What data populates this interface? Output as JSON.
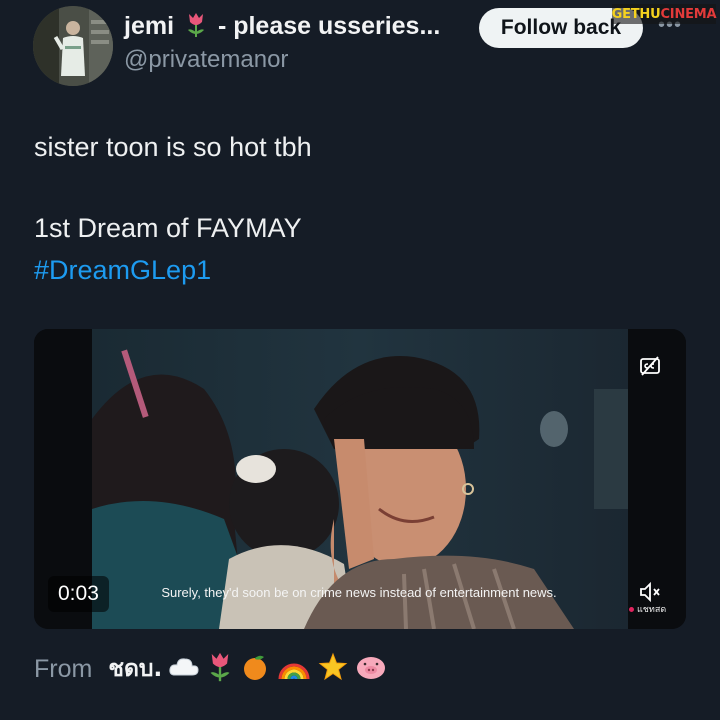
{
  "author": {
    "display_name": "jemi",
    "display_name_suffix": "- please usseries...",
    "handle": "@privatemanor",
    "avatar_icon": "avatar-photo",
    "name_emoji": "tulip-icon"
  },
  "header": {
    "follow_label": "Follow back",
    "more_label": "•••"
  },
  "watermark": {
    "part1": "GETHU",
    "part2": "CINEMA"
  },
  "tweet": {
    "line1": "sister toon is so hot tbh",
    "line2": "1st Dream of FAYMAY",
    "hashtag": "#DreamGLep1"
  },
  "video": {
    "timestamp": "0:03",
    "subtitle": "Surely, they'd soon be on crime news instead of entertainment news.",
    "live_label": "แชทสด",
    "cc_icon": "captions-off-icon",
    "mute_icon": "volume-muted-icon"
  },
  "source": {
    "from_label": "From",
    "name": "ชดบ.",
    "emojis": [
      "cloud-icon",
      "tulip-icon",
      "orange-icon",
      "rainbow-icon",
      "star-icon",
      "pig-icon"
    ]
  },
  "colors": {
    "background": "#151c26",
    "link": "#1d9bf0",
    "secondary_text": "#8b98a5",
    "button_bg": "#eff3f4"
  }
}
